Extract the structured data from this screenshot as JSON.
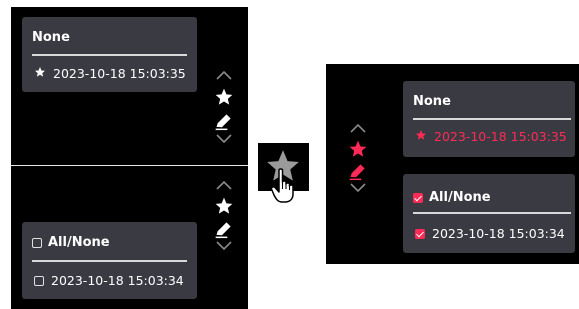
{
  "left_top": {
    "title": "None",
    "item_timestamp": "2023-10-18 15:03:35",
    "icons": [
      "chevron-up-icon",
      "star-icon",
      "pencil-icon",
      "chevron-down-icon"
    ]
  },
  "left_bottom": {
    "title": "All/None",
    "item_timestamp": "2023-10-18 15:03:34",
    "icons": [
      "chevron-up-icon",
      "star-icon",
      "pencil-icon",
      "chevron-down-icon"
    ]
  },
  "middle": {
    "icon": "star-hand-pointer-icon"
  },
  "right": {
    "favorite_group": {
      "title": "None",
      "item_timestamp": "2023-10-18 15:03:35"
    },
    "selection_group": {
      "title": "All/None",
      "item_timestamp": "2023-10-18 15:03:34"
    },
    "icons": [
      "chevron-up-icon",
      "star-icon",
      "pencil-icon",
      "chevron-down-icon"
    ]
  },
  "colors": {
    "panel_bg": "#000000",
    "card_bg": "#3a3a42",
    "accent": "#ff2a55",
    "text": "#ffffff",
    "muted_icon": "#8a8a8a"
  }
}
